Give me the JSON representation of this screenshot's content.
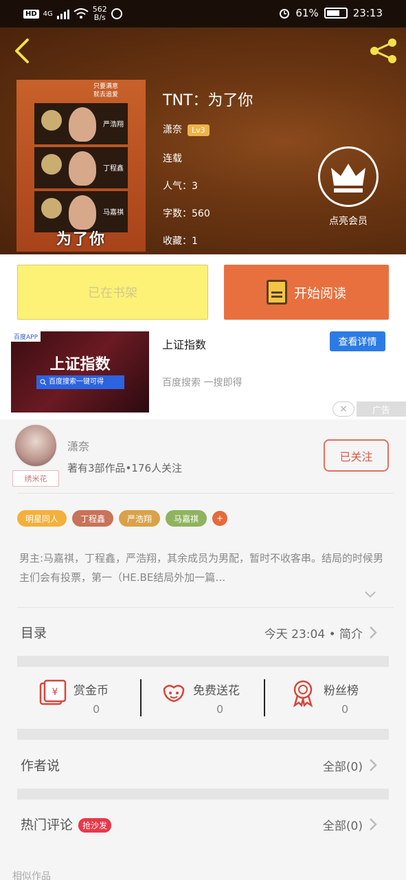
{
  "status_bar": {
    "hd": "HD",
    "network": "4G",
    "speed_value": "562",
    "speed_unit": "B/s",
    "battery": "61%",
    "time": "23:13"
  },
  "book": {
    "title": "TNT：为了你",
    "author": "潇奈",
    "level": "Lv3",
    "status": "连载",
    "popularity": "人气：3",
    "word_count": "字数：560",
    "favorites": "收藏：1",
    "cover_title": "为了你",
    "cover_note_1": "只要满意",
    "cover_note_2": "就去追爱",
    "cover_names": [
      "严浩翔",
      "丁程鑫",
      "马嘉祺"
    ]
  },
  "vip": {
    "label": "点亮会员"
  },
  "actions": {
    "shelf_label": "已在书架",
    "read_label": "开始阅读"
  },
  "ad": {
    "image_tag": "百度APP",
    "image_title": "上证指数",
    "image_bar": "百度搜索一键可得",
    "title": "上证指数",
    "subtitle": "百度搜索 一搜即得",
    "button": "查看详情",
    "close": "×",
    "mark": "广告"
  },
  "author": {
    "name": "潇奈",
    "stats": "著有3部作品•176人关注",
    "follow_label": "已关注",
    "avatar_tag": "绣米花"
  },
  "tags": [
    {
      "label": "明星同人",
      "color": "#f3b03c"
    },
    {
      "label": "丁程鑫",
      "color": "#c8735a"
    },
    {
      "label": "严浩翔",
      "color": "#d9a24a"
    },
    {
      "label": "马嘉祺",
      "color": "#8fb35e"
    }
  ],
  "tag_more": "+",
  "synopsis": "男主:马嘉祺，丁程鑫，严浩翔，其余成员为男配，暂时不收客串。结局的时候男主们会有投票，第一（HE.BE结局外加一篇…",
  "toc": {
    "label": "目录",
    "value": "今天 23:04 • 简介"
  },
  "stats": [
    {
      "label": "赏金币",
      "value": "0"
    },
    {
      "label": "免费送花",
      "value": "0"
    },
    {
      "label": "粉丝榜",
      "value": "0"
    }
  ],
  "author_says": {
    "label": "作者说",
    "value": "全部(0)"
  },
  "comments": {
    "label": "热门评论",
    "badge": "抢沙发",
    "value": "全部(0)"
  },
  "similar": {
    "label": "相似作品"
  },
  "colors": {
    "accent": "#e8703f",
    "shelf": "#fdf176",
    "vip_button": "#2c7be5"
  }
}
